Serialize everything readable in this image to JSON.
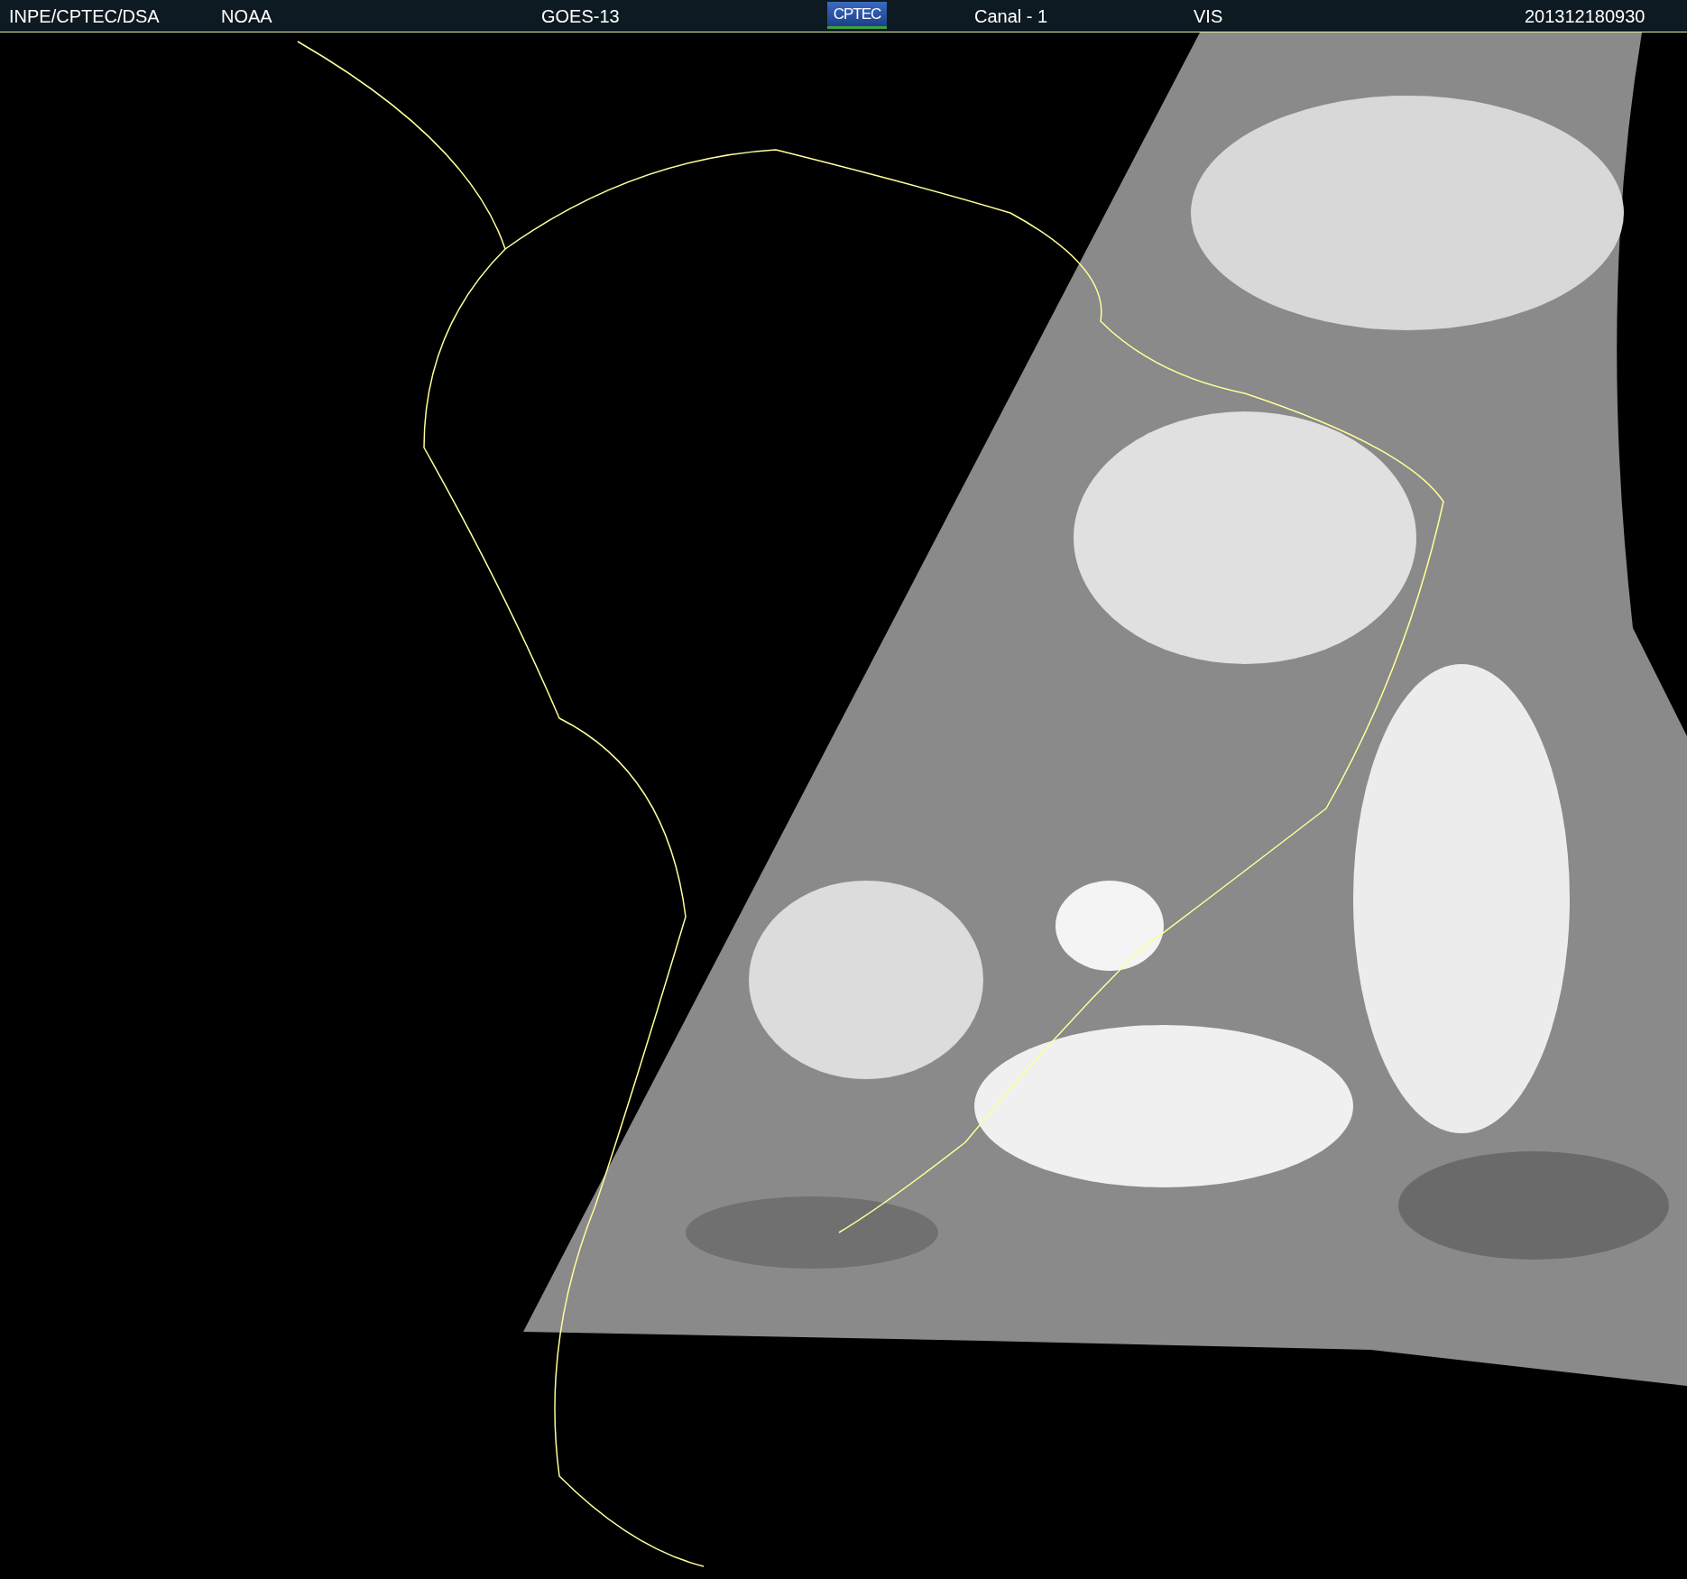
{
  "header": {
    "source": "INPE/CPTEC/DSA",
    "agency": "NOAA",
    "satellite": "GOES-13",
    "logo": "CPTEC",
    "channel": "Canal - 1",
    "band": "VIS",
    "timestamp": "201312180930"
  }
}
